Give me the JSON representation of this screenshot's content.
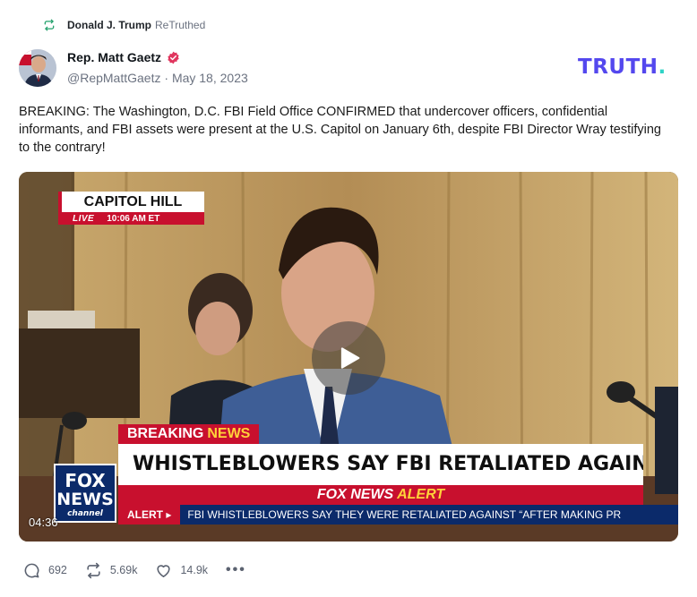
{
  "retruth": {
    "name": "Donald J. Trump",
    "word": "ReTruthed",
    "icon": "retruth-icon"
  },
  "author": {
    "name": "Rep. Matt Gaetz",
    "handle": "@RepMattGaetz",
    "separator": " · ",
    "date": "May 18, 2023",
    "verified_icon": "verified-badge-icon",
    "verified_color": "#e0365e"
  },
  "brand": {
    "name": "TRUTH",
    "dot": ".",
    "color": "#5448ee",
    "dot_color": "#2ed3c6"
  },
  "post": {
    "text": "BREAKING: The Washington, D.C. FBI Field Office CONFIRMED that undercover officers, confidential informants, and FBI assets were present at the U.S. Capitol on January 6th, despite FBI Director Wray testifying to the contrary!"
  },
  "video": {
    "duration": "04:36",
    "play_icon": "play-icon",
    "bug": {
      "location": "CAPITOL HILL",
      "live": "LIVE",
      "time": "10:06 AM ET"
    },
    "logo": {
      "line1": "FOX",
      "line2": "NEWS",
      "line3": "channel"
    },
    "tag": {
      "word1": "BREAKING",
      "word2": "NEWS"
    },
    "headline": "WHISTLEBLOWERS SAY FBI RETALIATED AGAINST THEM",
    "alert": {
      "brand": "FOX NEWS",
      "word": "ALERT"
    },
    "ticker": {
      "label": "ALERT ▸",
      "text": "FBI WHISTLEBLOWERS SAY THEY WERE RETALIATED AGAINST “AFTER MAKING PR"
    }
  },
  "actions": {
    "replies": "692",
    "retruths": "5.69k",
    "likes": "14.9k",
    "more": "•••"
  }
}
